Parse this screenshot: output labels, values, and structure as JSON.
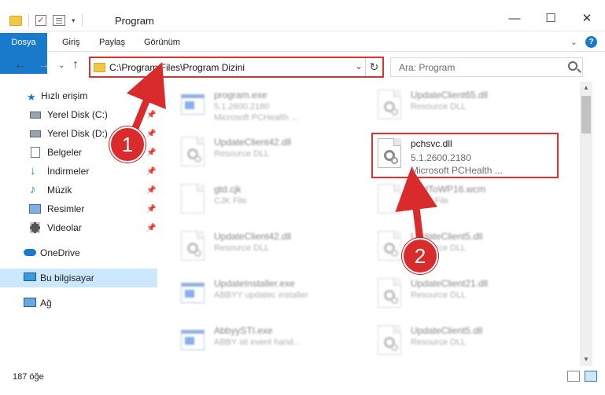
{
  "window": {
    "title": "Program",
    "minimize": "—",
    "maximize": "☐",
    "close": "✕"
  },
  "ribbon": {
    "tabs": [
      "Dosya",
      "Giriş",
      "Paylaş",
      "Görünüm"
    ],
    "expand": "⌄",
    "help": "?"
  },
  "address": {
    "path": "C:\\Program Files\\Program Dizini",
    "dropdown": "⌄",
    "refresh": "↻",
    "back": "←",
    "forward": "→",
    "recent": "⌄",
    "up": "↑"
  },
  "search": {
    "placeholder": "Ara: Program"
  },
  "sidebar": {
    "items": [
      {
        "label": "Hızlı erişim",
        "icon": "star-icon"
      },
      {
        "label": "Yerel Disk (C:)",
        "icon": "drive-icon",
        "pin": "📌"
      },
      {
        "label": "Yerel Disk (D:)",
        "icon": "drive-icon",
        "pin": "📌"
      },
      {
        "label": "Belgeler",
        "icon": "documents-icon",
        "pin": "📌"
      },
      {
        "label": "İndirmeler",
        "icon": "download-icon",
        "pin": "📌"
      },
      {
        "label": "Müzik",
        "icon": "music-icon",
        "pin": "📌"
      },
      {
        "label": "Resimler",
        "icon": "pictures-icon",
        "pin": "📌"
      },
      {
        "label": "Videolar",
        "icon": "videos-icon",
        "pin": "📌"
      },
      {
        "label": "OneDrive",
        "icon": "cloud-icon"
      },
      {
        "label": "Bu bilgisayar",
        "icon": "computer-icon"
      },
      {
        "label": "Ağ",
        "icon": "network-icon"
      }
    ]
  },
  "files": [
    {
      "name": "program.exe",
      "line1": "5.1.2600.2180",
      "line2": "Microsoft PCHealth ...",
      "kind": "exe-icon"
    },
    {
      "name": "UpdateClient65.dll",
      "line1": "Resource DLL",
      "line2": "",
      "kind": "dll-icon"
    },
    {
      "name": "UpdateClient42.dll",
      "line1": "Resource DLL",
      "line2": "",
      "kind": "dll-icon"
    },
    {
      "name": "pchsvc.dll",
      "line1": "5.1.2600.2180",
      "line2": "Microsoft PCHealth ...",
      "kind": "dll-icon"
    },
    {
      "name": "gtd.cjk",
      "line1": "CJK File",
      "line2": "",
      "kind": "file-icon"
    },
    {
      "name": "RedToWP16.wcm",
      "line1": "WCM File",
      "line2": "",
      "kind": "file-icon"
    },
    {
      "name": "UpdateClient42.dll",
      "line1": "Resource DLL",
      "line2": "",
      "kind": "dll-icon"
    },
    {
      "name": "UpdateClient5.dll",
      "line1": "Resource DLL",
      "line2": "",
      "kind": "dll-icon"
    },
    {
      "name": "UpdateInstaller.exe",
      "line1": "ABBYY updatec installer",
      "line2": "",
      "kind": "exe-icon"
    },
    {
      "name": "UpdateClient21.dll",
      "line1": "Resource DLL",
      "line2": "",
      "kind": "dll-icon"
    },
    {
      "name": "AbbyySTI.exe",
      "line1": "ABBY sti event hand...",
      "line2": "",
      "kind": "exe-icon"
    },
    {
      "name": "UpdateClient5.dll",
      "line1": "Resource DLL",
      "line2": "",
      "kind": "dll-icon"
    }
  ],
  "status": {
    "count": "187 öğe"
  },
  "callouts": [
    "1",
    "2"
  ],
  "colors": {
    "accent": "#1979ca",
    "highlight": "#e03030",
    "selected": "#cce8ff"
  }
}
